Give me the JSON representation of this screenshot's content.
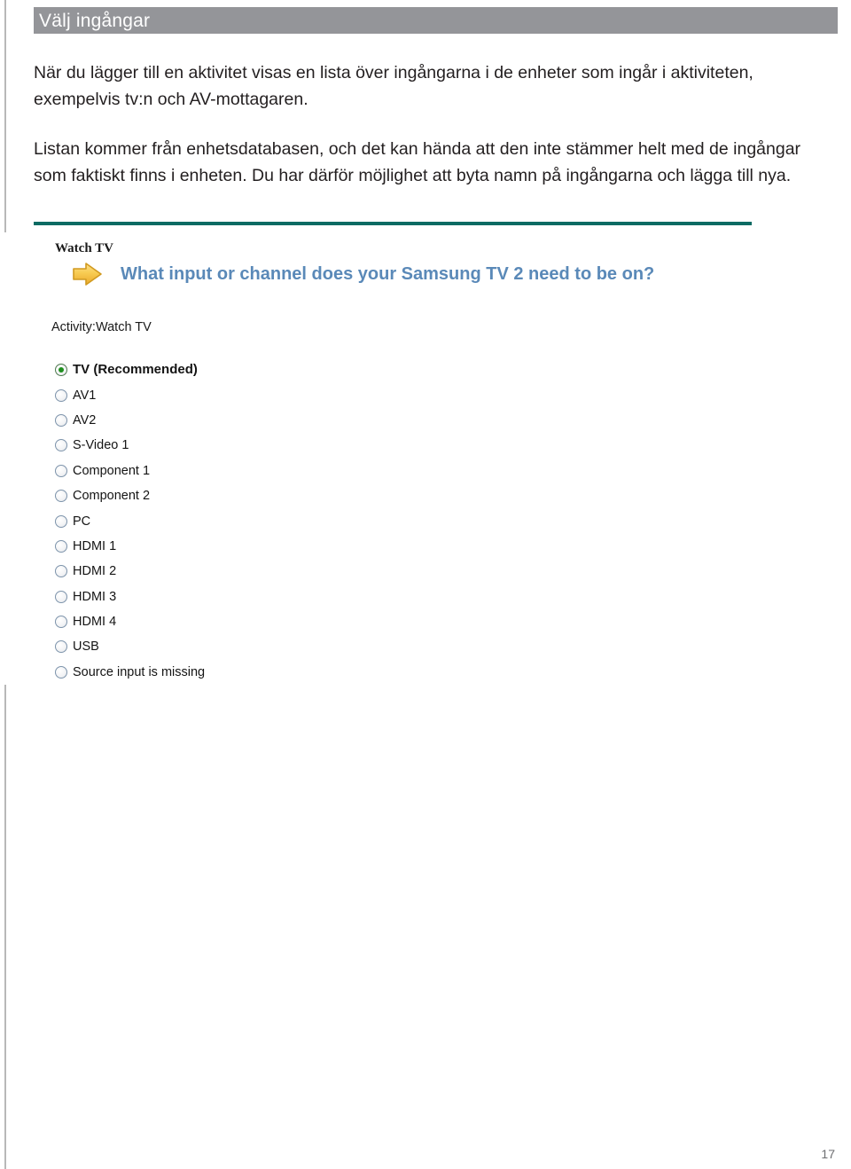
{
  "page": {
    "number": "17",
    "left_rule_color": "#b8b8b8"
  },
  "section": {
    "title": "Välj ingångar",
    "header_bg": "#949599",
    "header_text_color": "#ffffff"
  },
  "body": {
    "paragraph_1": "När du lägger till en aktivitet visas en lista över ingångarna i de enheter som ingår i aktiviteten, exempelvis tv:n och AV-mottagaren.",
    "paragraph_2": "Listan kommer från enhetsdatabasen, och det kan hända att den inte stämmer helt med de ingångar som faktiskt finns i enheten. Du har därför möjlighet att byta namn på ingångarna och lägga till nya."
  },
  "divider": {
    "color": "#0c6b63"
  },
  "screenshot": {
    "activity_title": "Watch TV",
    "arrow_icon_name": "arrow-right-icon",
    "arrow_fill": "#f5c242",
    "question": "What input or channel does your Samsung TV 2 need to be on?",
    "question_color": "#5a89b8",
    "activity_label": "Activity:Watch TV",
    "selected_index": 0,
    "selected_dot_color": "#1f8f1f",
    "inputs": [
      {
        "label": "TV (Recommended)",
        "selected": true
      },
      {
        "label": "AV1",
        "selected": false
      },
      {
        "label": "AV2",
        "selected": false
      },
      {
        "label": "S-Video 1",
        "selected": false
      },
      {
        "label": "Component 1",
        "selected": false
      },
      {
        "label": "Component 2",
        "selected": false
      },
      {
        "label": "PC",
        "selected": false
      },
      {
        "label": "HDMI 1",
        "selected": false
      },
      {
        "label": "HDMI 2",
        "selected": false
      },
      {
        "label": "HDMI 3",
        "selected": false
      },
      {
        "label": "HDMI 4",
        "selected": false
      },
      {
        "label": "USB",
        "selected": false
      },
      {
        "label": "Source input is missing",
        "selected": false
      }
    ]
  }
}
